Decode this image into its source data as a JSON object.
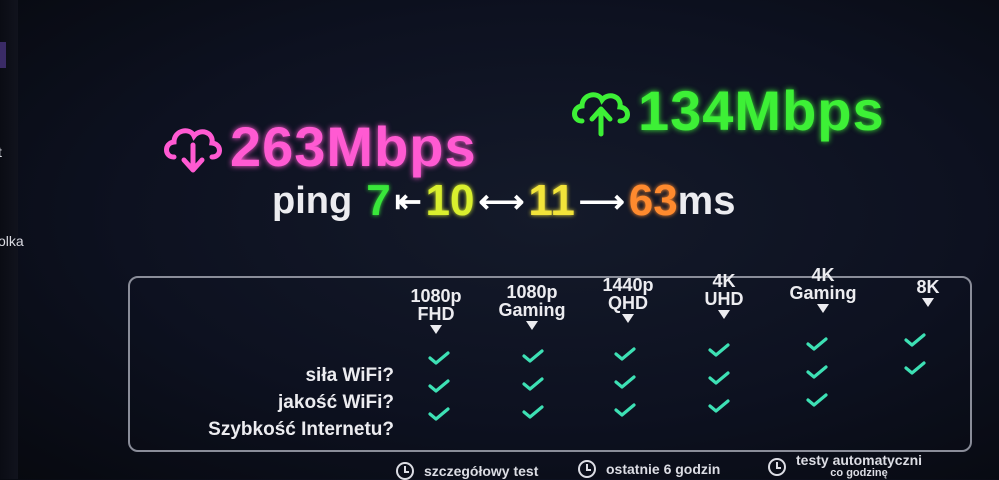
{
  "sidebar": {
    "labels": [
      "t",
      "olka"
    ]
  },
  "download": {
    "value": "263Mbps",
    "icon": "cloud-download-icon",
    "color": "#ff5ad2"
  },
  "upload": {
    "value": "134Mbps",
    "icon": "cloud-upload-icon",
    "color": "#3df036"
  },
  "ping": {
    "label": "ping",
    "values": [
      {
        "value": "7",
        "color": "#39e83a"
      },
      {
        "value": "10",
        "color": "#d9ef2e"
      },
      {
        "value": "11",
        "color": "#f2e43a"
      },
      {
        "value": "63",
        "color": "#ff8a2e"
      }
    ],
    "arrows": [
      "⇤",
      "⟷",
      "⟶"
    ],
    "unit": "ms"
  },
  "table": {
    "columns": [
      {
        "line1": "1080p",
        "line2": "FHD"
      },
      {
        "line1": "1080p",
        "line2": "Gaming"
      },
      {
        "line1": "1440p",
        "line2": "QHD"
      },
      {
        "line1": "4K",
        "line2": "UHD"
      },
      {
        "line1": "4K",
        "line2": "Gaming"
      },
      {
        "line1": "8K",
        "line2": ""
      }
    ],
    "rows": [
      {
        "label": "siła WiFi?",
        "status": [
          true,
          true,
          true,
          true,
          true,
          true
        ]
      },
      {
        "label": "jakość WiFi?",
        "status": [
          true,
          true,
          true,
          true,
          true,
          true
        ]
      },
      {
        "label": "Szybkość Internetu?",
        "status": [
          true,
          true,
          true,
          true,
          true,
          false
        ]
      }
    ],
    "check_color": "#3de0b4"
  },
  "footer": {
    "items": [
      {
        "label": "szczegółowy test"
      },
      {
        "label": "ostatnie 6 godzin"
      },
      {
        "label": "testy automatyczni",
        "sub": "co godzinę"
      }
    ]
  }
}
